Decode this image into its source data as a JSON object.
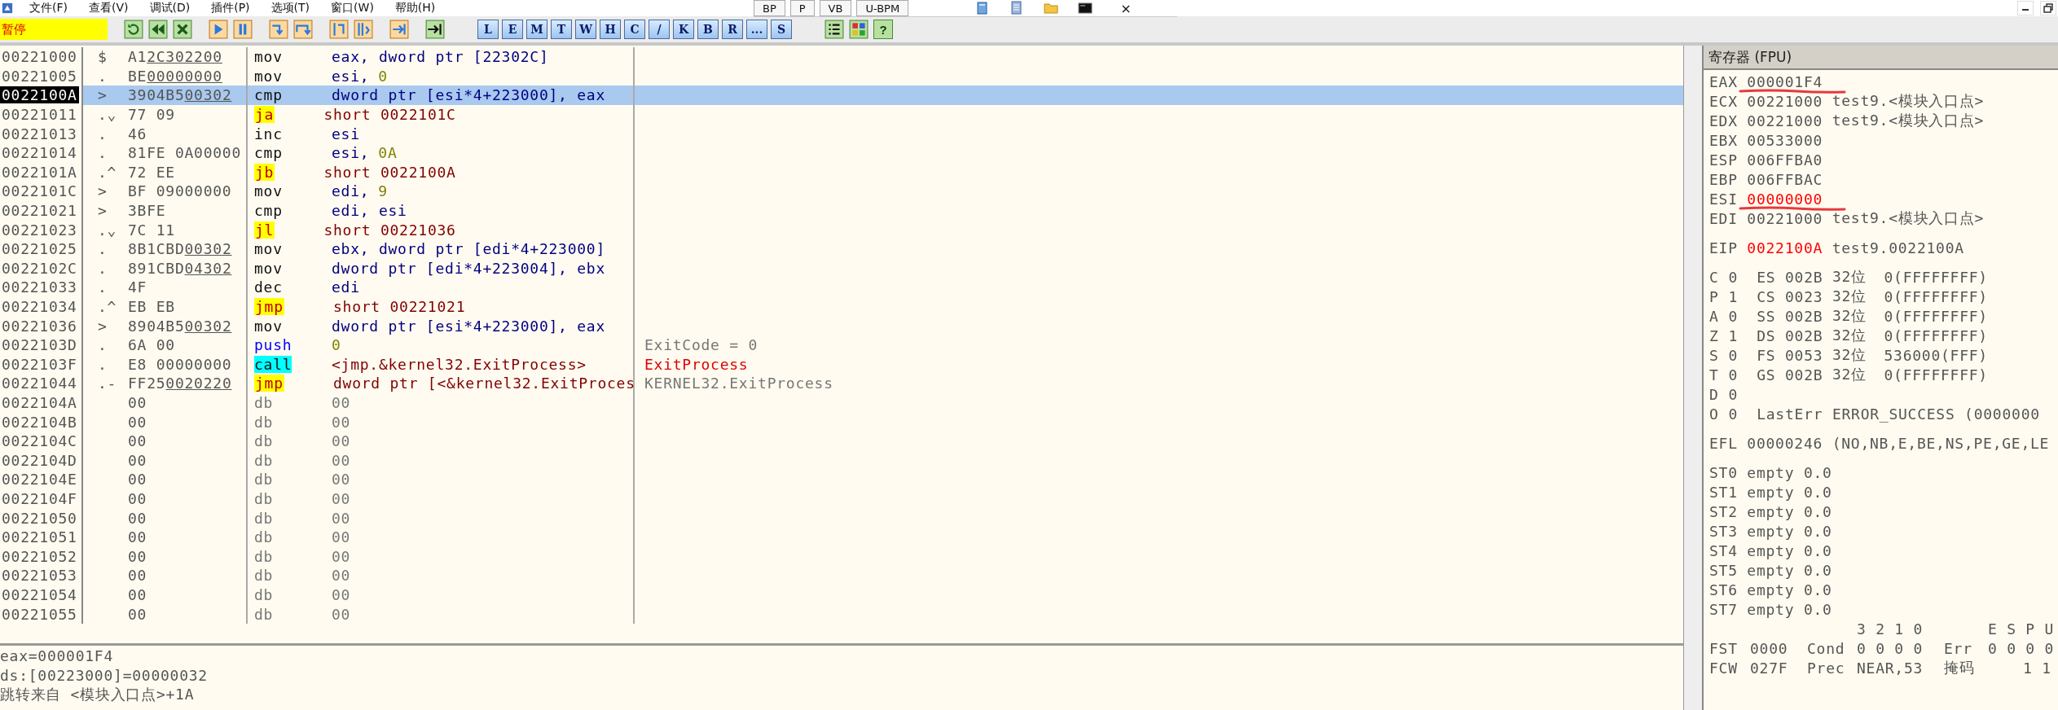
{
  "menu": [
    "文件(F)",
    "查看(V)",
    "调试(D)",
    "插件(P)",
    "选项(T)",
    "窗口(W)",
    "帮助(H)"
  ],
  "floating_toolbar": {
    "buttons": [
      "BP",
      "P",
      "VB",
      "U-BPM"
    ],
    "close": "×"
  },
  "toolbar": {
    "status": "暂停",
    "letter_buttons": [
      "L",
      "E",
      "M",
      "T",
      "W",
      "H",
      "C",
      "/",
      "K",
      "B",
      "R",
      "...",
      "S"
    ],
    "help": "?"
  },
  "disassembly": {
    "rows": [
      {
        "address": "00221000",
        "marker": "$",
        "opcode": "A1",
        "fixup": "2C302200",
        "kind": "normal",
        "mnemonic": "mov",
        "operand": "eax, dword ptr [22302C]",
        "selected": false
      },
      {
        "address": "00221005",
        "marker": ".",
        "opcode": "BE",
        "fixup": "00000000",
        "kind": "normal",
        "mnemonic": "mov",
        "operand": "esi,",
        "immediate": "0",
        "selected": false
      },
      {
        "address": "0022100A",
        "marker": ">",
        "opcode": "3904B5",
        "fixup": "00302",
        "kind": "normal",
        "mnemonic": "cmp",
        "operand": "dword ptr [esi*4+223000], eax",
        "selected": true
      },
      {
        "address": "00221011",
        "marker": ".⌄",
        "opcode": "77 09",
        "kind": "jump",
        "mnemonic": "ja",
        "operand": "short 0022101C",
        "selected": false
      },
      {
        "address": "00221013",
        "marker": ".",
        "opcode": "46",
        "kind": "normal",
        "mnemonic": "inc",
        "operand": "esi",
        "selected": false
      },
      {
        "address": "00221014",
        "marker": ".",
        "opcode": "81FE 0A00000",
        "kind": "normal",
        "mnemonic": "cmp",
        "operand": "esi,",
        "immediate": "0A",
        "selected": false
      },
      {
        "address": "0022101A",
        "marker": ".^",
        "opcode": "72 EE",
        "kind": "jump",
        "mnemonic": "jb",
        "operand": "short 0022100A",
        "selected": false
      },
      {
        "address": "0022101C",
        "marker": ">",
        "opcode": "BF 09000000",
        "kind": "normal",
        "mnemonic": "mov",
        "operand": "edi,",
        "immediate": "9",
        "selected": false
      },
      {
        "address": "00221021",
        "marker": ">",
        "opcode": "3BFE",
        "kind": "normal",
        "mnemonic": "cmp",
        "operand": "edi, esi",
        "selected": false
      },
      {
        "address": "00221023",
        "marker": ".⌄",
        "opcode": "7C 11",
        "kind": "jump",
        "mnemonic": "jl",
        "operand": "short 00221036",
        "selected": false
      },
      {
        "address": "00221025",
        "marker": ".",
        "opcode": "8B1CBD",
        "fixup": "00302",
        "kind": "normal",
        "mnemonic": "mov",
        "operand": "ebx, dword ptr [edi*4+223000]",
        "selected": false
      },
      {
        "address": "0022102C",
        "marker": ".",
        "opcode": "891CBD",
        "fixup": "04302",
        "kind": "normal",
        "mnemonic": "mov",
        "operand": "dword ptr [edi*4+223004], ebx",
        "selected": false
      },
      {
        "address": "00221033",
        "marker": ".",
        "opcode": "4F",
        "kind": "normal",
        "mnemonic": "dec",
        "operand": "edi",
        "selected": false
      },
      {
        "address": "00221034",
        "marker": ".^",
        "opcode": "EB EB",
        "kind": "jump",
        "mnemonic": "jmp",
        "operand": "short 00221021",
        "selected": false
      },
      {
        "address": "00221036",
        "marker": ">",
        "opcode": "8904B5",
        "fixup": "00302",
        "kind": "normal",
        "mnemonic": "mov",
        "operand": "dword ptr [esi*4+223000], eax",
        "selected": false
      },
      {
        "address": "0022103D",
        "marker": ".",
        "opcode": "6A 00",
        "kind": "push",
        "mnemonic": "push",
        "immediate": "0",
        "comment": "ExitCode = 0",
        "comment_highlight": false,
        "selected": false
      },
      {
        "address": "0022103F",
        "marker": ".",
        "opcode": "E8 00000000",
        "kind": "call",
        "mnemonic": "call",
        "operand": "<jmp.&kernel32.ExitProcess>",
        "comment": "ExitProcess",
        "comment_highlight": true,
        "selected": false
      },
      {
        "address": "00221044",
        "marker": ".-",
        "opcode": "FF25",
        "fixup": "0020220",
        "kind": "jump",
        "mnemonic": "jmp",
        "operand": "dword ptr [<&kernel32.ExitProces",
        "comment": "KERNEL32.ExitProcess",
        "comment_highlight": false,
        "selected": false
      },
      {
        "address": "0022104A",
        "opcode": "00",
        "kind": "data",
        "mnemonic": "db",
        "operand": "00",
        "selected": false
      },
      {
        "address": "0022104B",
        "opcode": "00",
        "kind": "data",
        "mnemonic": "db",
        "operand": "00",
        "selected": false
      },
      {
        "address": "0022104C",
        "opcode": "00",
        "kind": "data",
        "mnemonic": "db",
        "operand": "00",
        "selected": false
      },
      {
        "address": "0022104D",
        "opcode": "00",
        "kind": "data",
        "mnemonic": "db",
        "operand": "00",
        "selected": false
      },
      {
        "address": "0022104E",
        "opcode": "00",
        "kind": "data",
        "mnemonic": "db",
        "operand": "00",
        "selected": false
      },
      {
        "address": "0022104F",
        "opcode": "00",
        "kind": "data",
        "mnemonic": "db",
        "operand": "00",
        "selected": false
      },
      {
        "address": "00221050",
        "opcode": "00",
        "kind": "data",
        "mnemonic": "db",
        "operand": "00",
        "selected": false
      },
      {
        "address": "00221051",
        "opcode": "00",
        "kind": "data",
        "mnemonic": "db",
        "operand": "00",
        "selected": false
      },
      {
        "address": "00221052",
        "opcode": "00",
        "kind": "data",
        "mnemonic": "db",
        "operand": "00",
        "selected": false
      },
      {
        "address": "00221053",
        "opcode": "00",
        "kind": "data",
        "mnemonic": "db",
        "operand": "00",
        "selected": false
      },
      {
        "address": "00221054",
        "opcode": "00",
        "kind": "data",
        "mnemonic": "db",
        "operand": "00",
        "selected": false
      },
      {
        "address": "00221055",
        "opcode": "00",
        "kind": "data",
        "mnemonic": "db",
        "operand": "00",
        "selected": false
      }
    ]
  },
  "info": [
    "eax=000001F4",
    "ds:[00223000]=00000032",
    "跳转来自 <模块入口点>+1A"
  ],
  "registers": {
    "title": "寄存器 (FPU)",
    "general": [
      {
        "name": "EAX",
        "value": "000001F4",
        "changed": false,
        "annotated": true
      },
      {
        "name": "ECX",
        "value": "00221000",
        "comment": "test9.<模块入口点>",
        "changed": false,
        "annotated": false
      },
      {
        "name": "EDX",
        "value": "00221000",
        "comment": "test9.<模块入口点>",
        "changed": false,
        "annotated": false
      },
      {
        "name": "EBX",
        "value": "00533000",
        "changed": false,
        "annotated": false
      },
      {
        "name": "ESP",
        "value": "006FFBA0",
        "changed": false,
        "annotated": false
      },
      {
        "name": "EBP",
        "value": "006FFBAC",
        "changed": false,
        "annotated": false
      },
      {
        "name": "ESI",
        "value": "00000000",
        "changed": true,
        "annotated": true
      },
      {
        "name": "EDI",
        "value": "00221000",
        "comment": "test9.<模块入口点>",
        "changed": false,
        "annotated": false
      }
    ],
    "eip": {
      "name": "EIP",
      "value": "0022100A",
      "comment": "test9.0022100A",
      "changed": true
    },
    "flags": [
      {
        "name": "C",
        "value": "0",
        "segment": "ES",
        "selector": "002B",
        "bits": "32位",
        "base": "0(FFFFFFFF)"
      },
      {
        "name": "P",
        "value": "1",
        "segment": "CS",
        "selector": "0023",
        "bits": "32位",
        "base": "0(FFFFFFFF)"
      },
      {
        "name": "A",
        "value": "0",
        "segment": "SS",
        "selector": "002B",
        "bits": "32位",
        "base": "0(FFFFFFFF)"
      },
      {
        "name": "Z",
        "value": "1",
        "segment": "DS",
        "selector": "002B",
        "bits": "32位",
        "base": "0(FFFFFFFF)"
      },
      {
        "name": "S",
        "value": "0",
        "segment": "FS",
        "selector": "0053",
        "bits": "32位",
        "base": "536000(FFF)"
      },
      {
        "name": "T",
        "value": "0",
        "segment": "GS",
        "selector": "002B",
        "bits": "32位",
        "base": "0(FFFFFFFF)"
      },
      {
        "name": "D",
        "value": "0"
      },
      {
        "name": "O",
        "value": "0",
        "last_error_label": "LastErr",
        "last_error": "ERROR_SUCCESS (0000000"
      }
    ],
    "efl": {
      "name": "EFL",
      "value": "00000246",
      "decoded": "(NO,NB,E,BE,NS,PE,GE,LE"
    },
    "fpu_stack": [
      {
        "name": "ST0",
        "tag": "empty",
        "value": "0.0"
      },
      {
        "name": "ST1",
        "tag": "empty",
        "value": "0.0"
      },
      {
        "name": "ST2",
        "tag": "empty",
        "value": "0.0"
      },
      {
        "name": "ST3",
        "tag": "empty",
        "value": "0.0"
      },
      {
        "name": "ST4",
        "tag": "empty",
        "value": "0.0"
      },
      {
        "name": "ST5",
        "tag": "empty",
        "value": "0.0"
      },
      {
        "name": "ST6",
        "tag": "empty",
        "value": "0.0"
      },
      {
        "name": "ST7",
        "tag": "empty",
        "value": "0.0"
      }
    ],
    "fpu_header": {
      "cond_bits": "3 2 1 0",
      "err_bits": "E S P U"
    },
    "fst": {
      "name": "FST",
      "value": "0000",
      "cond_label": "Cond",
      "cond": "0 0 0 0",
      "err_label": "Err",
      "err": "0 0 0 0"
    },
    "fcw": {
      "name": "FCW",
      "value": "027F",
      "prec_label": "Prec",
      "prec": "NEAR,53",
      "mask_label": "掩码",
      "mask": "1 1"
    }
  }
}
